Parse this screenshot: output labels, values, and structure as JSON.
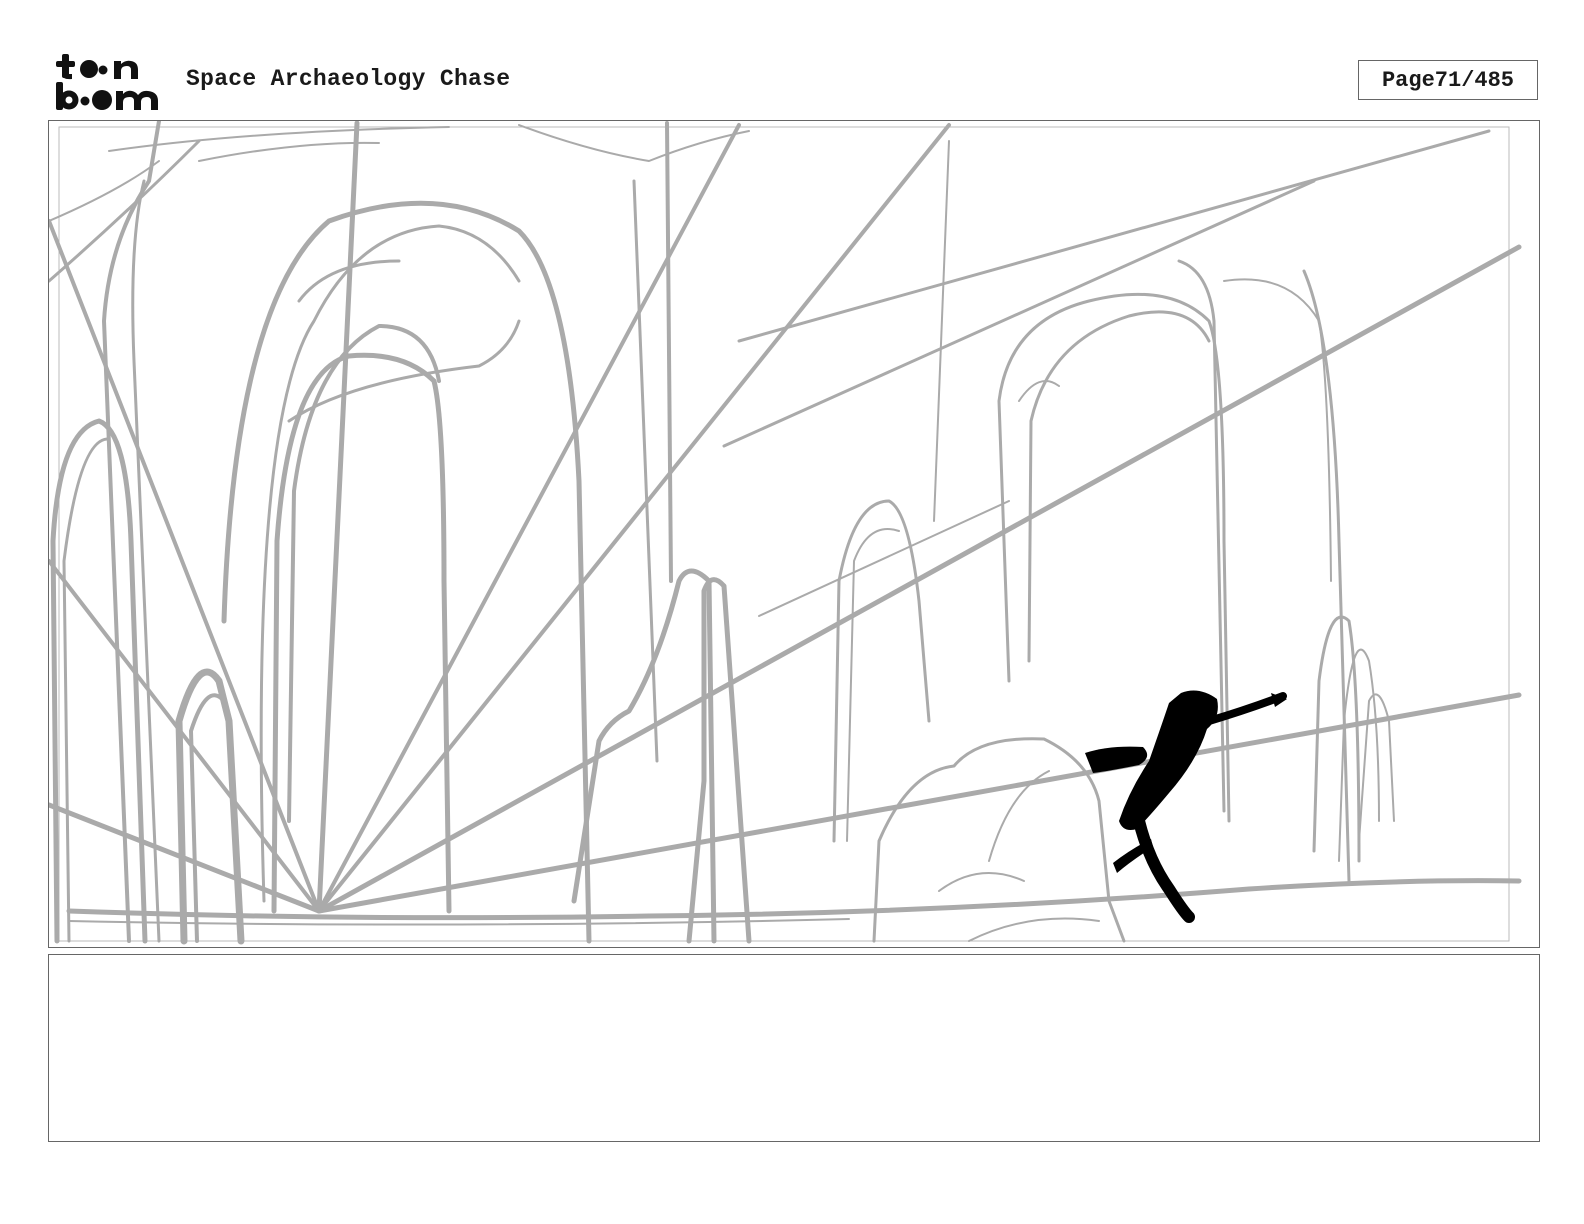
{
  "header": {
    "logo_text": "toon boom",
    "project_title": "Space Archaeology Chase",
    "page_label": "Page",
    "page_number": "71/485"
  },
  "panel": {
    "sketch_color": "#aaaaaa",
    "character_color": "#000000"
  },
  "notes": {
    "text": ""
  }
}
